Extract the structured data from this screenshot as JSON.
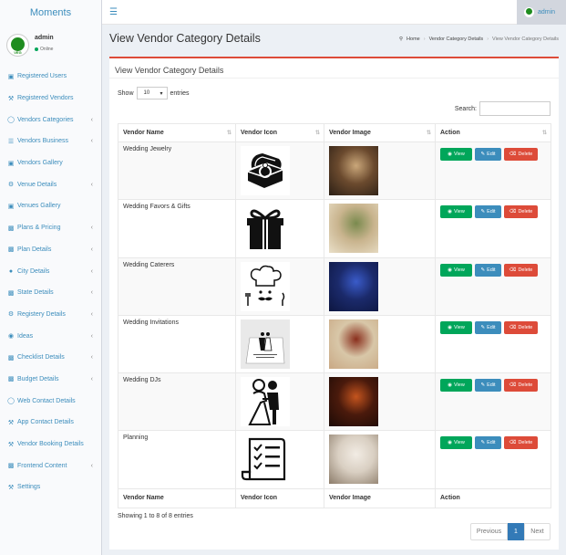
{
  "brand": "Moments",
  "user": {
    "name": "admin",
    "status": "Online",
    "avatar_text": "VEG"
  },
  "topbar": {
    "admin_label": "admin"
  },
  "sidebar": {
    "items": [
      {
        "label": "Registered Users",
        "icon": "image-icon",
        "chevron": false
      },
      {
        "label": "Registered Vendors",
        "icon": "wrench-icon",
        "chevron": false
      },
      {
        "label": "Vendors Categories",
        "icon": "bulb-icon",
        "chevron": true
      },
      {
        "label": "Vendors Business",
        "icon": "list-icon",
        "chevron": true
      },
      {
        "label": "Vendors Gallery",
        "icon": "image-icon",
        "chevron": false
      },
      {
        "label": "Venue Details",
        "icon": "gear-icon",
        "chevron": true
      },
      {
        "label": "Venues Gallery",
        "icon": "image-icon",
        "chevron": false
      },
      {
        "label": "Plans & Pricing",
        "icon": "card-icon",
        "chevron": true
      },
      {
        "label": "Plan Details",
        "icon": "card-icon",
        "chevron": true
      },
      {
        "label": "City Details",
        "icon": "globe-icon",
        "chevron": true
      },
      {
        "label": "State Details",
        "icon": "card-icon",
        "chevron": true
      },
      {
        "label": "Registery Details",
        "icon": "gear-icon",
        "chevron": true
      },
      {
        "label": "Ideas",
        "icon": "eye-icon",
        "chevron": true
      },
      {
        "label": "Checklist Details",
        "icon": "card-icon",
        "chevron": true
      },
      {
        "label": "Budget Details",
        "icon": "card-icon",
        "chevron": true
      },
      {
        "label": "Web Contact Details",
        "icon": "bulb-icon",
        "chevron": false
      },
      {
        "label": "App Contact Details",
        "icon": "wrench-icon",
        "chevron": false
      },
      {
        "label": "Vendor Booking Details",
        "icon": "wrench-icon",
        "chevron": false
      },
      {
        "label": "Frontend Content",
        "icon": "card-icon",
        "chevron": true
      },
      {
        "label": "Settings",
        "icon": "wrench-icon",
        "chevron": false
      }
    ]
  },
  "page": {
    "title": "View Vendor Category Details",
    "breadcrumb": {
      "home": "Home",
      "parent": "Vendor Category Details",
      "current": "View Vendor Category Details"
    }
  },
  "box": {
    "title": "View Vendor Category Details",
    "show_label": "Show",
    "entries_value": "10",
    "entries_label": "entries",
    "search_label": "Search:"
  },
  "table": {
    "headers": [
      "Vendor Name",
      "Vendor Icon",
      "Vendor Image",
      "Action"
    ],
    "rows": [
      {
        "name": "Wedding Jewelry",
        "icon": "ring-box-icon",
        "image_colors": [
          "#6b4a2e",
          "#caa77a",
          "#2b1f15"
        ]
      },
      {
        "name": "Wedding Favors & Gifts",
        "icon": "gift-icon",
        "image_colors": [
          "#c9b48e",
          "#7a8a4e",
          "#e9dfc8"
        ]
      },
      {
        "name": "Wedding Caterers",
        "icon": "chef-icon",
        "image_colors": [
          "#1b2a6b",
          "#3a5bc9",
          "#0d1640"
        ]
      },
      {
        "name": "Wedding Invitations",
        "icon": "invitation-card-icon",
        "image_colors": [
          "#d8c7a8",
          "#8a2f1d",
          "#c9a884"
        ]
      },
      {
        "name": "Wedding DJs",
        "icon": "couple-icon",
        "image_colors": [
          "#4a1a0c",
          "#c4541e",
          "#1d0b06"
        ]
      },
      {
        "name": "Planning",
        "icon": "checklist-icon",
        "image_colors": [
          "#d9cfc2",
          "#f2ece4",
          "#8c7c6a"
        ]
      }
    ],
    "actions": {
      "view": "View",
      "edit": "Edit",
      "delete": "Delete"
    }
  },
  "footer": {
    "info": "Showing 1 to 8 of 8 entries",
    "prev": "Previous",
    "page": "1",
    "next": "Next"
  },
  "colors": {
    "accent": "#3c8dbc",
    "view": "#00a65a",
    "delete": "#dd4b39",
    "box_border": "#dd4b39",
    "page_active": "#337ab7"
  }
}
